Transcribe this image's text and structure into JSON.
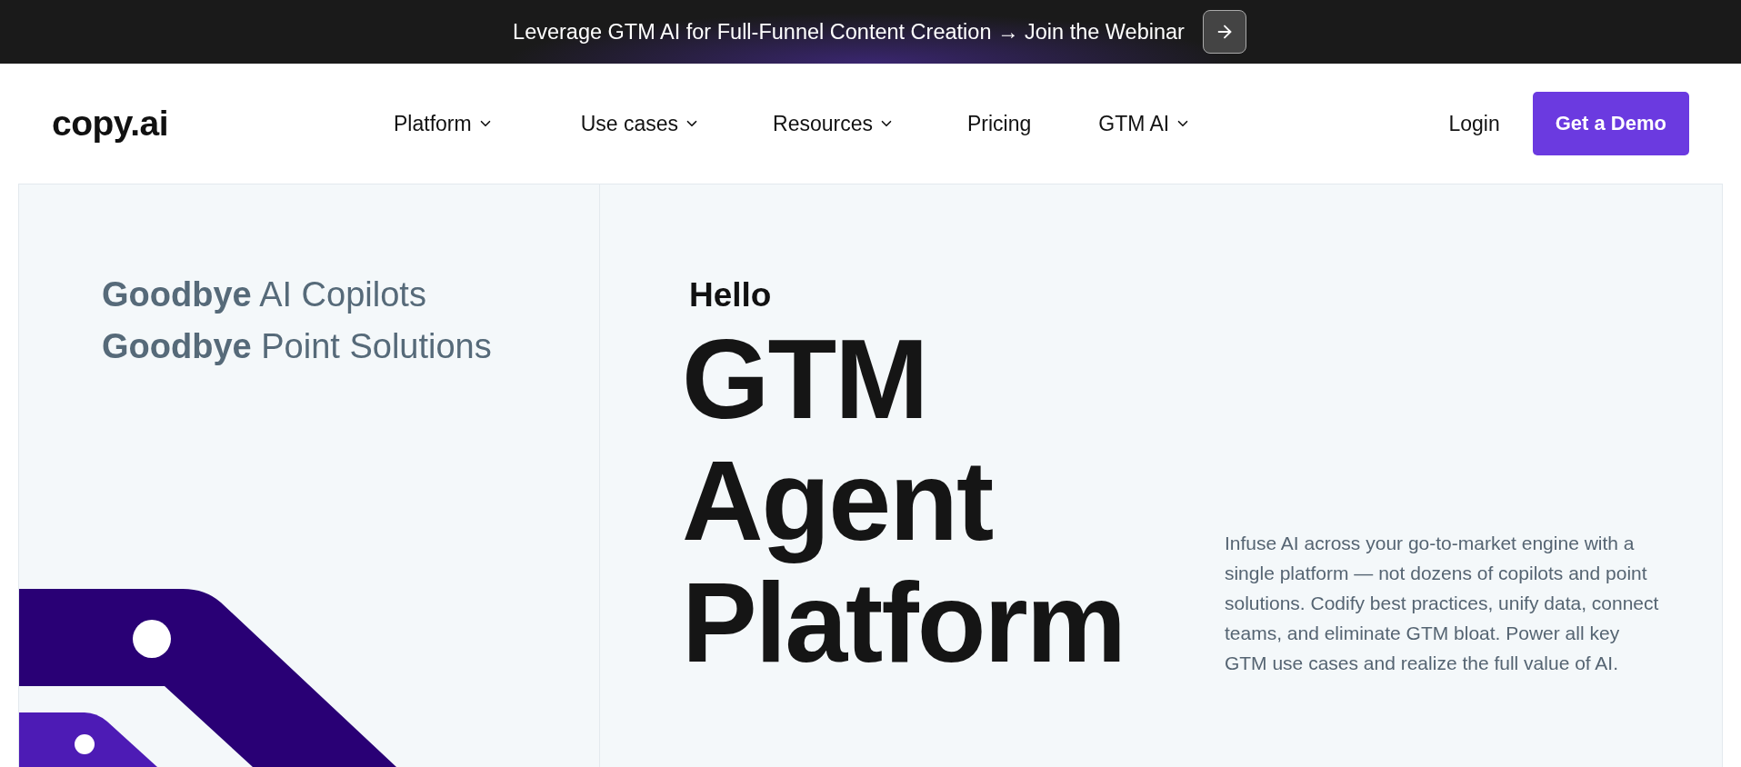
{
  "banner": {
    "text": "Leverage GTM AI for Full-Funnel Content Creation → Join the Webinar"
  },
  "nav": {
    "logo": "copy.ai",
    "items": [
      {
        "label": "Platform",
        "has_dropdown": true
      },
      {
        "label": "Use cases",
        "has_dropdown": true
      },
      {
        "label": "Resources",
        "has_dropdown": true
      },
      {
        "label": "Pricing",
        "has_dropdown": false
      },
      {
        "label": "GTM AI",
        "has_dropdown": true
      }
    ],
    "login": "Login",
    "cta": "Get a Demo"
  },
  "hero": {
    "goodbyes": [
      "**Goodbye** AI Copilots",
      "**Goodbye** Point Solutions"
    ],
    "eyebrow": "Hello",
    "title": "GTM Agent Platform",
    "description": "Infuse AI across your go-to-market engine with a single platform — not dozens of copilots and point solutions. Codify best practices, unify data, connect teams, and eliminate GTM bloat. Power all key GTM use cases and realize the full value of AI."
  }
}
